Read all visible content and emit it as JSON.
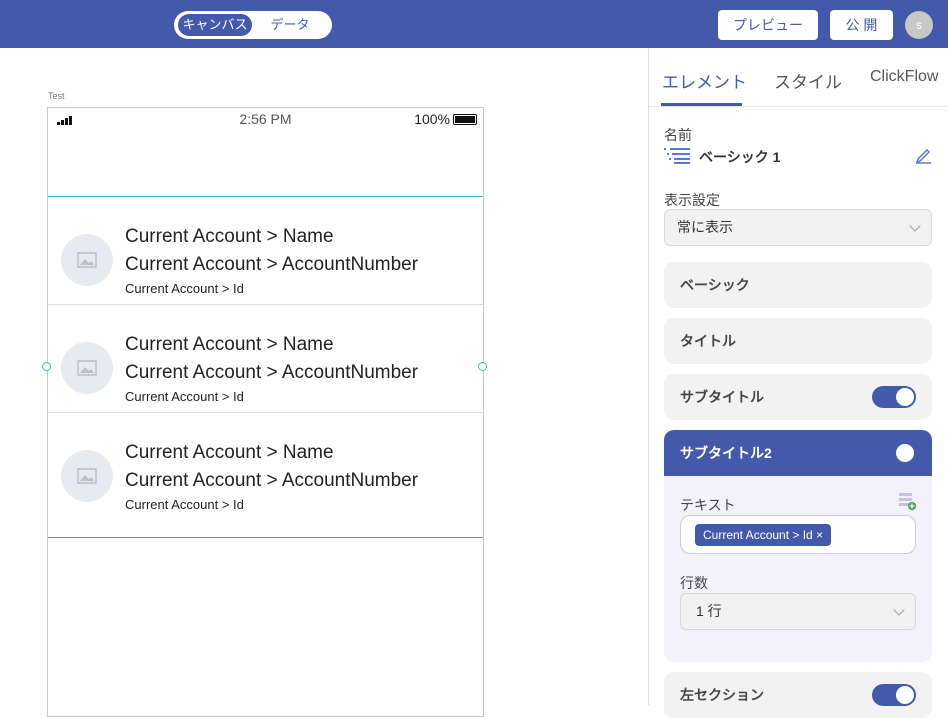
{
  "topbar": {
    "mode_tabs": [
      "キャンバス",
      "データ"
    ],
    "preview_label": "プレビュー",
    "publish_label": "公 開",
    "avatar_initial": "s"
  },
  "canvas": {
    "screen_name": "Test",
    "status": {
      "time": "2:56 PM",
      "battery": "100%"
    },
    "rows": [
      {
        "name": "Current Account > Name",
        "number": "Current Account > AccountNumber",
        "id": "Current Account > Id"
      },
      {
        "name": "Current Account > Name",
        "number": "Current Account > AccountNumber",
        "id": "Current Account > Id"
      },
      {
        "name": "Current Account > Name",
        "number": "Current Account > AccountNumber",
        "id": "Current Account > Id"
      }
    ]
  },
  "panel": {
    "tabs": [
      "エレメント",
      "スタイル",
      "ClickFlow"
    ],
    "active_tab": "エレメント",
    "name_label": "名前",
    "element_name": "ベーシック 1",
    "visibility_label": "表示設定",
    "visibility_value": "常に表示",
    "sections": {
      "basic": "ベーシック",
      "title": "タイトル",
      "subtitle": "サブタイトル",
      "subtitle2": "サブタイトル2",
      "left_section": "左セクション"
    },
    "toggles": {
      "subtitle": true,
      "subtitle2": true,
      "left_section": true
    },
    "text_label": "テキスト",
    "text_tag": "Current Account > Id",
    "lines_label": "行数",
    "lines_value": "1 行"
  },
  "colors": {
    "brand": "#435aab",
    "selection": "#3bb6c8"
  }
}
